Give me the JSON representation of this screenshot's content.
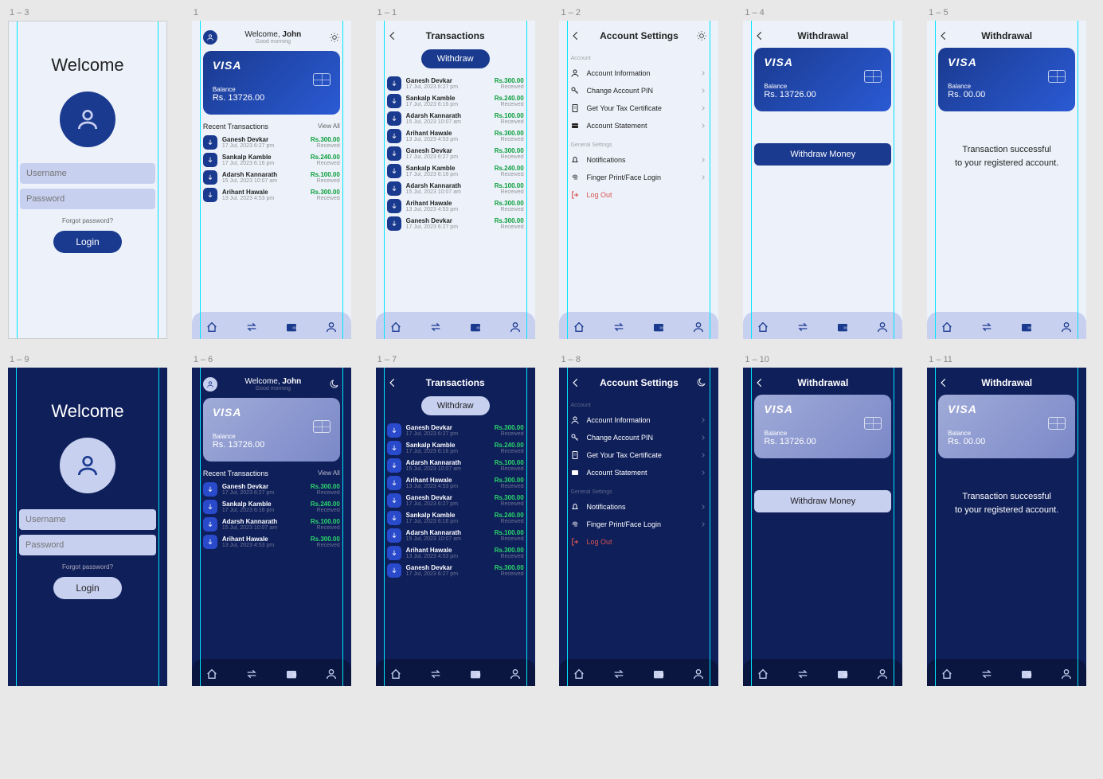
{
  "labels": {
    "s1": "1 – 3",
    "s2": "1",
    "s3": "1 – 1",
    "s4": "1 – 2",
    "s5": "1 – 4",
    "s6": "1 – 5",
    "s7": "1 – 9",
    "s8": "1 – 6",
    "s9": "1 – 7",
    "s10": "1 – 8",
    "s11": "1 – 10",
    "s12": "1 – 11"
  },
  "login": {
    "title": "Welcome",
    "username_ph": "Username",
    "password_ph": "Password",
    "forgot": "Forgot password?",
    "btn": "Login"
  },
  "home": {
    "welcome": "Welcome, ",
    "name": "John",
    "greet": "Good morning",
    "section": "Recent Transactions",
    "viewall": "View All"
  },
  "card": {
    "brand": "VISA",
    "bal_lbl": "Balance",
    "bal": "Rs. 13726.00",
    "bal_zero": "Rs. 00.00"
  },
  "txpage": {
    "title": "Transactions",
    "withdraw": "Withdraw"
  },
  "settings": {
    "title": "Account Settings",
    "grp1": "Account",
    "grp2": "General Settings",
    "items1": [
      "Account Information",
      "Change Account PIN",
      "Get Your Tax Certificate",
      "Account Statement"
    ],
    "items2": [
      "Notifications",
      "Finger Print/Face Login"
    ],
    "logout": "Log Out"
  },
  "withdrawal": {
    "title": "Withdrawal",
    "btn": "Withdraw Money",
    "success1": "Transaction successful",
    "success2": "to your registered account."
  },
  "tx": [
    {
      "name": "Ganesh Devkar",
      "date": "17 Jul, 2023  6:27 pm",
      "amt": "Rs.300.00",
      "stat": "Received"
    },
    {
      "name": "Sankalp Kamble",
      "date": "17 Jul, 2023  6:16 pm",
      "amt": "Rs.240.00",
      "stat": "Received"
    },
    {
      "name": "Adarsh Kannarath",
      "date": "15 Jul, 2023  10:07 am",
      "amt": "Rs.100.00",
      "stat": "Received"
    },
    {
      "name": "Arihant Hawale",
      "date": "13 Jul, 2023  4:53 pm",
      "amt": "Rs.300.00",
      "stat": "Received"
    },
    {
      "name": "Ganesh Devkar",
      "date": "17 Jul, 2023  6:27 pm",
      "amt": "Rs.300.00",
      "stat": "Received"
    },
    {
      "name": "Sankalp Kamble",
      "date": "17 Jul, 2023  6:16 pm",
      "amt": "Rs.240.00",
      "stat": "Received"
    },
    {
      "name": "Adarsh Kannarath",
      "date": "15 Jul, 2023  10:07 am",
      "amt": "Rs.100.00",
      "stat": "Received"
    },
    {
      "name": "Arihant Hawale",
      "date": "13 Jul, 2023  4:53 pm",
      "amt": "Rs.300.00",
      "stat": "Received"
    },
    {
      "name": "Ganesh Devkar",
      "date": "17 Jul, 2023  6:27 pm",
      "amt": "Rs.300.00",
      "stat": "Received"
    }
  ]
}
